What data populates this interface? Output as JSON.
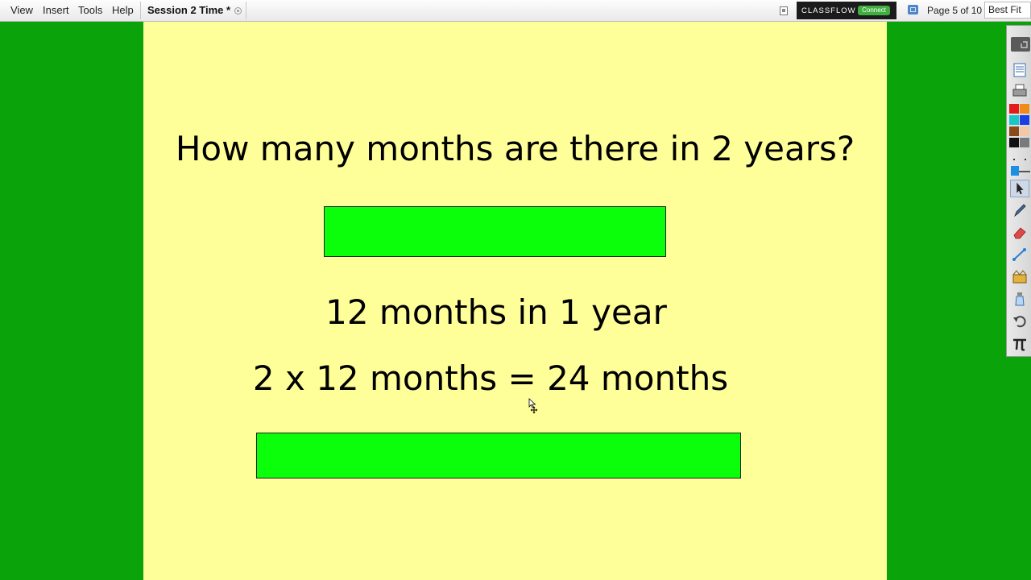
{
  "menubar": {
    "items": [
      "View",
      "Insert",
      "Tools",
      "Help"
    ],
    "document_tab": "Session 2 Time *",
    "classflow_label": "CLASSFLOW",
    "connect_label": "Connect",
    "page_indicator": "Page 5 of 10",
    "zoom_value": "Best Fit"
  },
  "flipchart": {
    "background_color": "#ffff99",
    "cover_color": "#0bff0b",
    "question": "How many months are there in 2 years?",
    "line1": "12 months in 1 year",
    "line2": "2 x 12 months = 24 months"
  },
  "toolbar": {
    "tools": [
      "expand-icon",
      "page-browser-icon",
      "print-icon",
      "color-palette",
      "select-arrow-icon",
      "pen-icon",
      "eraser-icon",
      "connector-icon",
      "magic-ink-icon",
      "reveal-icon",
      "undo-icon",
      "math-pi-icon"
    ],
    "palette": [
      "#e31b1b",
      "#f08a18",
      "#18c8c8",
      "#1b3fe3",
      "#8a4a1a",
      "#f2c8a8",
      "#111111",
      "#7a7a7a"
    ]
  }
}
